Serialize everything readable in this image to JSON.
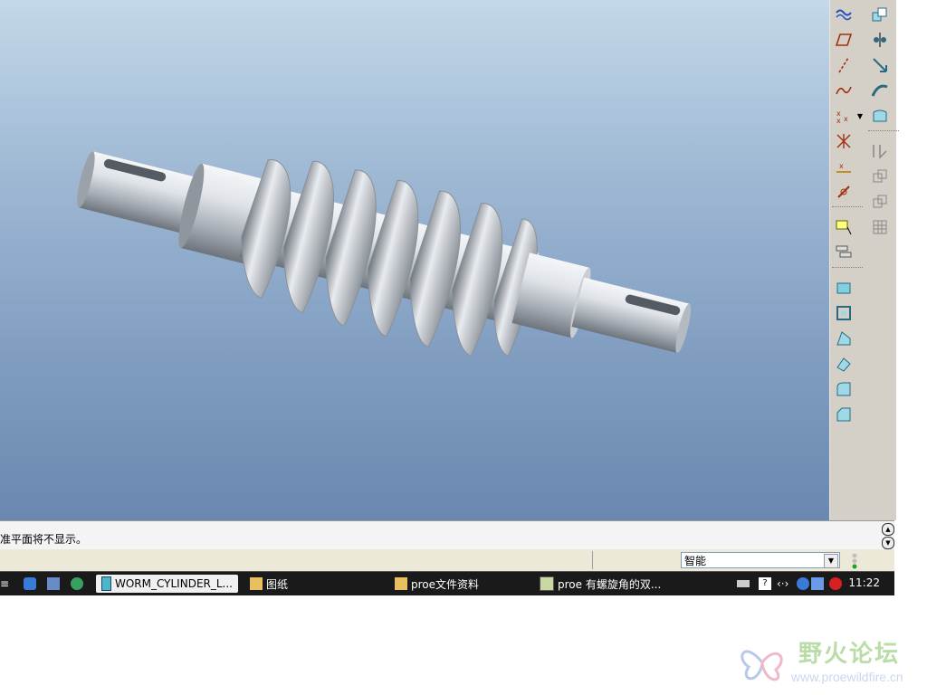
{
  "viewport": {
    "model_name": "worm shaft 3D model"
  },
  "toolbar": {
    "col1": [
      "sketch-curve-icon",
      "plane-icon",
      "axis-icon",
      "spline-curve-icon",
      "datum-point-icon",
      "offset-point-icon",
      "coordinate-system-icon",
      "analysis-icon",
      "note-icon",
      "layer-icon",
      "extrude-icon",
      "shell-icon",
      "rib-icon",
      "draft-icon",
      "round-icon",
      "chamfer-icon"
    ],
    "col2": [
      "copy-icon",
      "mirror-point-icon",
      "move-icon",
      "sweep-icon",
      "blend-icon",
      "merge-icon",
      "pattern-icon",
      "pattern-dim-icon",
      "table-grid-icon"
    ]
  },
  "message": {
    "text": "准平面将不显示。"
  },
  "status": {
    "filter_value": "智能"
  },
  "taskbar": {
    "items": [
      {
        "label": "WORM_CYLINDER_L...",
        "active": true
      },
      {
        "label": "图纸"
      },
      {
        "label": "proe文件资料"
      },
      {
        "label": "proe 有螺旋角的双..."
      }
    ],
    "clock": "11:22"
  },
  "watermark": {
    "title": "野火论坛",
    "url": "www.proewildfire.cn"
  },
  "colors": {
    "viewport_top": "#c3d8e8",
    "viewport_bottom": "#6a88b0",
    "toolbar_bg": "#d4d0c8",
    "taskbar_bg": "#1a1a1a"
  }
}
